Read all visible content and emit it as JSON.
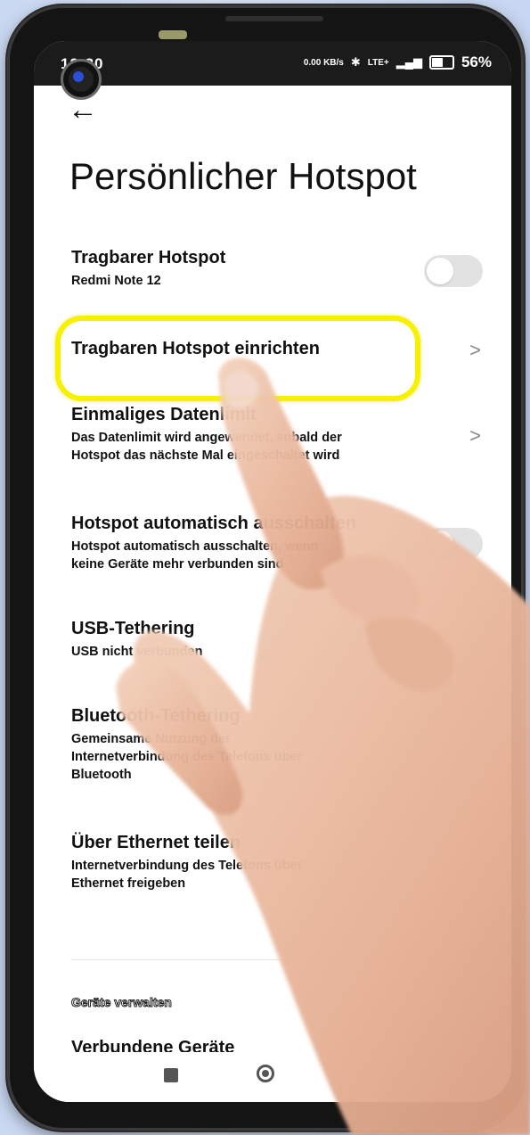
{
  "status_bar": {
    "time": "12:30",
    "left_extra": "≋ ···",
    "net_speed": "0.00 KB/s",
    "network": "LTE+",
    "battery": "56%"
  },
  "page": {
    "title": "Persönlicher Hotspot"
  },
  "settings": [
    {
      "title": "Tragbarer Hotspot",
      "subtitle": "Redmi Note 12",
      "control": "toggle",
      "on": false
    },
    {
      "title": "Tragbaren Hotspot einrichten",
      "subtitle": "",
      "control": "chevron",
      "highlighted": true
    },
    {
      "title": "Einmaliges Datenlimit",
      "subtitle1": "Das Datenlimit wird angewendet, sobald der",
      "subtitle2": "Hotspot das nächste Mal eingeschaltet wird",
      "control": "chevron"
    },
    {
      "title": "Hotspot automatisch ausschalten",
      "subtitle1": "Hotspot automatisch ausschalten, wenn",
      "subtitle2": "keine Geräte mehr verbunden sind",
      "control": "toggle",
      "on": false
    },
    {
      "title": "USB-Tethering",
      "subtitle": "USB nicht verbunden"
    },
    {
      "title": "Bluetooth-Tethering",
      "subtitle1": "Gemeinsame Nutzung der",
      "subtitle2": "Internetverbindung des Telefons über",
      "subtitle3": "Bluetooth"
    },
    {
      "title": "Über Ethernet teilen",
      "subtitle1": "Internetverbindung des Telefons über",
      "subtitle2": "Ethernet freigeben"
    }
  ],
  "section": {
    "label": "Geräte verwalten",
    "connected_title": "Verbundene Geräte"
  },
  "colors": {
    "highlight": "#f7f000",
    "status_bar": "#1b1b1b",
    "toggle_off": "#e2e2e2"
  }
}
